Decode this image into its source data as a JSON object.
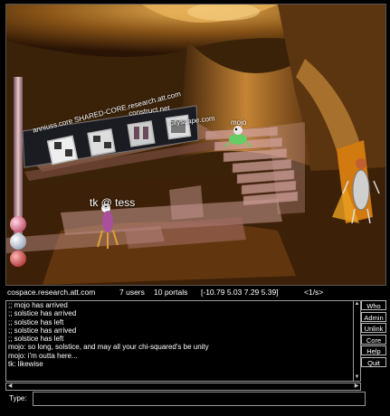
{
  "viewport": {
    "portals": {
      "shared": "anniuss.core SHARED-CORE.research.att.com",
      "construct": "construct.net",
      "cityscape": "cityscape.com"
    },
    "users": {
      "mojo": "mojo",
      "tk": "tk @ tess"
    }
  },
  "status": {
    "host": "cospace.research.att.com",
    "users": "7 users",
    "portals": "10 portals",
    "coords": "[-10.79 5.03 7.29 5.39]",
    "rate": "<1/s>"
  },
  "chat": {
    "lines": [
      ";; mojo has arrived",
      ";; solstice has arrived",
      ";; solstice has left",
      ";; solstice has arrived",
      ";; solstice has left",
      "mojo: so long, solstice, and may all your chi-squared's be unity",
      "mojo: i'm outta here...",
      "tk: likewise"
    ]
  },
  "buttons": {
    "who": "Who",
    "admin": "Admin",
    "unlink": "Unlink",
    "core": "Core",
    "help": "Help",
    "quit": "Quit"
  },
  "input": {
    "label": "Type:",
    "value": ""
  },
  "colors": {
    "background": "#000000",
    "scene_wood": "#b57a2e",
    "stair_pink": "#c89a93"
  }
}
